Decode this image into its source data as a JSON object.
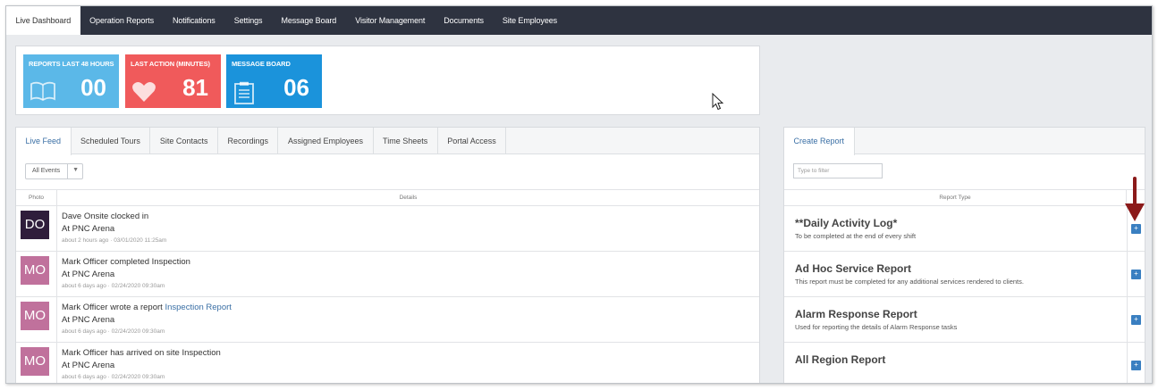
{
  "nav": {
    "items": [
      {
        "label": "Live Dashboard",
        "active": true
      },
      {
        "label": "Operation Reports"
      },
      {
        "label": "Notifications"
      },
      {
        "label": "Settings"
      },
      {
        "label": "Message Board"
      },
      {
        "label": "Visitor Management"
      },
      {
        "label": "Documents"
      },
      {
        "label": "Site Employees"
      }
    ]
  },
  "stats": {
    "tiles": [
      {
        "label": "REPORTS LAST 48 HOURS",
        "value": "00",
        "icon": "book-icon",
        "color": "#5bb8e8"
      },
      {
        "label": "LAST ACTION (MINUTES)",
        "value": "81",
        "icon": "heart-icon",
        "color": "#f05a5b"
      },
      {
        "label": "MESSAGE BOARD",
        "value": "06",
        "icon": "clipboard-icon",
        "color": "#1b93db"
      }
    ]
  },
  "feed": {
    "tabs": [
      {
        "label": "Live Feed",
        "active": true
      },
      {
        "label": "Scheduled Tours"
      },
      {
        "label": "Site Contacts"
      },
      {
        "label": "Recordings"
      },
      {
        "label": "Assigned Employees"
      },
      {
        "label": "Time Sheets"
      },
      {
        "label": "Portal Access"
      }
    ],
    "filter_value": "All Events",
    "columns": {
      "photo": "Photo",
      "details": "Details"
    },
    "rows": [
      {
        "initials": "DO",
        "avatar_color": "#2f1d3b",
        "message": "Dave Onsite clocked in",
        "link": "",
        "location": "At PNC Arena",
        "time": "about 2 hours ago",
        "timestamp": "03/01/2020 11:25am"
      },
      {
        "initials": "MO",
        "avatar_color": "#c0719c",
        "message": "Mark Officer completed Inspection",
        "link": "",
        "location": "At PNC Arena",
        "time": "about 6 days ago",
        "timestamp": "02/24/2020 09:30am"
      },
      {
        "initials": "MO",
        "avatar_color": "#c0719c",
        "message": "Mark Officer wrote a report ",
        "link": "Inspection Report",
        "location": "At PNC Arena",
        "time": "about 6 days ago",
        "timestamp": "02/24/2020 09:30am"
      },
      {
        "initials": "MO",
        "avatar_color": "#c0719c",
        "message": "Mark Officer has arrived on site Inspection",
        "link": "",
        "location": "At PNC Arena",
        "time": "about 6 days ago",
        "timestamp": "02/24/2020 09:30am"
      }
    ]
  },
  "report": {
    "tab_label": "Create Report",
    "filter_placeholder": "Type to filter",
    "column_header": "Report Type",
    "add_icon": "plus-icon",
    "rows": [
      {
        "title": "**Daily Activity Log*",
        "description": "To be completed at the end of every shift"
      },
      {
        "title": "Ad Hoc Service Report",
        "description": "This report must be completed for any additional services rendered to clients."
      },
      {
        "title": "Alarm Response Report",
        "description": "Used for reporting the details of Alarm Response tasks"
      },
      {
        "title": "All Region Report",
        "description": ""
      }
    ]
  },
  "colors": {
    "nav_bg": "#2e3340",
    "annotation_arrow": "#8b1a1a",
    "link": "#3a6fa5",
    "add_button": "#3a7fc1"
  }
}
